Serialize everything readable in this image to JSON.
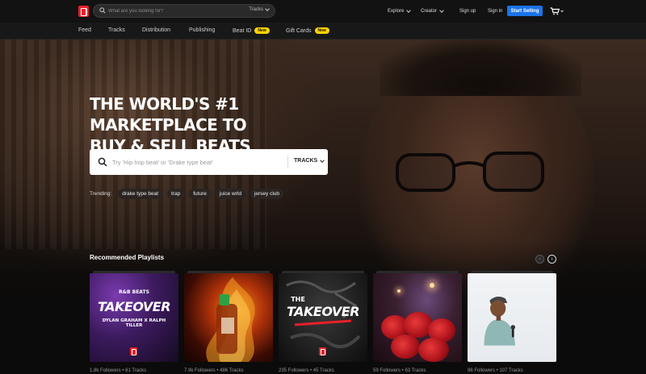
{
  "header": {
    "search_placeholder": "What are you looking for?",
    "search_scope": "Tracks",
    "explore": "Explore",
    "creator": "Creator",
    "signup": "Sign up",
    "signin": "Sign in",
    "start_selling": "Start Selling"
  },
  "subnav": {
    "feed": "Feed",
    "tracks": "Tracks",
    "distribution": "Distribution",
    "publishing": "Publishing",
    "beat_id": "Beat ID",
    "gift_cards": "Gift Cards",
    "new_badge": "New"
  },
  "hero": {
    "headline_line1": "THE WORLD'S #1 MARKETPLACE TO",
    "headline_line2": "BUY & SELL BEATS",
    "search_placeholder": "Try 'Hip hop beat' or 'Drake type beat'",
    "search_type": "TRACKS",
    "trending_label": "Trending:",
    "trending": [
      "drake type beat",
      "trap",
      "future",
      "juice wrld",
      "jersey club"
    ]
  },
  "playlists": {
    "title": "Recommended Playlists",
    "cards": [
      {
        "art_top": "R&B BEATS",
        "art_title": "TAKEOVER",
        "art_sub": "DYLAN GRAHAM X RALPH TILLER",
        "meta": "1.8k Followers • 61 Tracks"
      },
      {
        "meta": "7.9k Followers • 486 Tracks"
      },
      {
        "art_top": "THE",
        "art_title": "TAKEOVER",
        "meta": "235 Followers • 45 Tracks"
      },
      {
        "meta": "59 Followers • 63 Tracks"
      },
      {
        "meta": "96 Followers • 107 Tracks"
      }
    ]
  },
  "colors": {
    "brand": "#e8202a",
    "accent": "#1a73e8",
    "badge": "#ffd400"
  }
}
